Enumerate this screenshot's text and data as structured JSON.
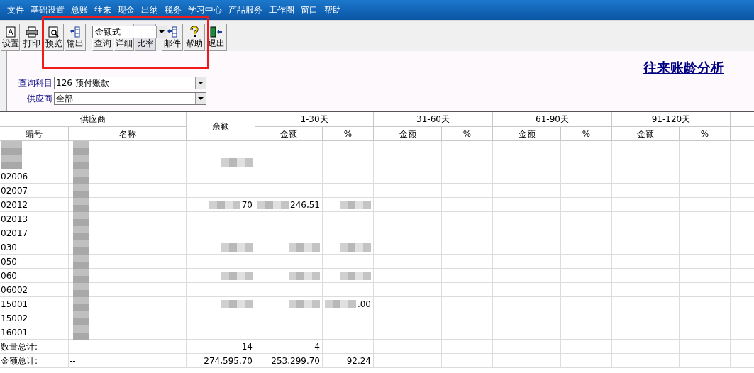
{
  "menu": [
    "文件",
    "基础设置",
    "总账",
    "往来",
    "现金",
    "出纳",
    "税务",
    "学习中心",
    "产品服务",
    "工作圈",
    "窗口",
    "帮助"
  ],
  "toolbar": [
    {
      "label": "设置"
    },
    {
      "label": "打印"
    },
    {
      "label": "预览"
    },
    {
      "label": "输出"
    },
    {
      "label": "查询"
    },
    {
      "label": "详细"
    },
    {
      "label": "比率"
    },
    {
      "label": "邮件"
    },
    {
      "label": "帮助"
    },
    {
      "label": "退出"
    }
  ],
  "mode_select": {
    "value": "金额式"
  },
  "report_title": "往来账龄分析",
  "filters": [
    {
      "label": "查询科目",
      "value": "126 预付账款"
    },
    {
      "label": "供应商",
      "value": "全部"
    }
  ],
  "table": {
    "group_headers": [
      "供应商",
      "余额",
      "1-30天",
      "31-60天",
      "61-90天",
      "91-120天"
    ],
    "sub_headers": [
      "编号",
      "名称",
      "金额",
      "%",
      "金额",
      "%",
      "金额",
      "%",
      "金额",
      "%"
    ],
    "rows": [
      {
        "cells": [
          "",
          "",
          "",
          "",
          "",
          "",
          "",
          "",
          "",
          "",
          ""
        ],
        "pixelated": [
          true,
          true,
          false,
          false,
          false,
          false,
          false,
          false,
          false,
          false,
          false
        ]
      },
      {
        "cells": [
          "",
          "",
          "",
          "",
          "",
          "",
          "",
          "",
          "",
          "",
          ""
        ],
        "pixelated": [
          true,
          true,
          true,
          false,
          false,
          false,
          false,
          false,
          false,
          false,
          false
        ]
      },
      {
        "cells": [
          "02006",
          "",
          "",
          "",
          "",
          "",
          "",
          "",
          "",
          "",
          ""
        ],
        "pixelated": [
          false,
          true,
          false,
          false,
          false,
          false,
          false,
          false,
          false,
          false,
          false
        ]
      },
      {
        "cells": [
          "02007",
          "",
          "",
          "",
          "",
          "",
          "",
          "",
          "",
          "",
          ""
        ],
        "pixelated": [
          false,
          true,
          false,
          false,
          false,
          false,
          false,
          false,
          false,
          false,
          false
        ]
      },
      {
        "cells": [
          "02012",
          "",
          "70",
          "246,51",
          "",
          "",
          "",
          "",
          "",
          "",
          ""
        ],
        "pixelated": [
          false,
          true,
          true,
          true,
          true,
          false,
          false,
          false,
          false,
          false,
          false
        ]
      },
      {
        "cells": [
          "02013",
          "",
          "",
          "",
          "",
          "",
          "",
          "",
          "",
          "",
          ""
        ],
        "pixelated": [
          false,
          true,
          false,
          false,
          false,
          false,
          false,
          false,
          false,
          false,
          false
        ]
      },
      {
        "cells": [
          "02017",
          "",
          "",
          "",
          "",
          "",
          "",
          "",
          "",
          "",
          ""
        ],
        "pixelated": [
          false,
          true,
          false,
          false,
          false,
          false,
          false,
          false,
          false,
          false,
          false
        ]
      },
      {
        "cells": [
          "030",
          "",
          "",
          "",
          "",
          "",
          "",
          "",
          "",
          "",
          ""
        ],
        "pixelated": [
          false,
          true,
          true,
          true,
          true,
          false,
          false,
          false,
          false,
          false,
          false
        ]
      },
      {
        "cells": [
          "050",
          "",
          "",
          "",
          "",
          "",
          "",
          "",
          "",
          "",
          ""
        ],
        "pixelated": [
          false,
          true,
          false,
          false,
          false,
          false,
          false,
          false,
          false,
          false,
          false
        ]
      },
      {
        "cells": [
          "060",
          "",
          "",
          "",
          "",
          "",
          "",
          "",
          "",
          "",
          ""
        ],
        "pixelated": [
          false,
          true,
          true,
          true,
          true,
          false,
          false,
          false,
          false,
          false,
          false
        ]
      },
      {
        "cells": [
          "06002",
          "",
          "",
          "",
          "",
          "",
          "",
          "",
          "",
          "",
          ""
        ],
        "pixelated": [
          false,
          true,
          false,
          false,
          false,
          false,
          false,
          false,
          false,
          false,
          false
        ]
      },
      {
        "cells": [
          "15001",
          "",
          "",
          "",
          ".00",
          "",
          "",
          "",
          "",
          "",
          ""
        ],
        "pixelated": [
          false,
          true,
          true,
          true,
          true,
          false,
          false,
          false,
          false,
          false,
          false
        ]
      },
      {
        "cells": [
          "15002",
          "",
          "",
          "",
          "",
          "",
          "",
          "",
          "",
          "",
          ""
        ],
        "pixelated": [
          false,
          true,
          false,
          false,
          false,
          false,
          false,
          false,
          false,
          false,
          false
        ]
      },
      {
        "cells": [
          "16001",
          "",
          "",
          "",
          "",
          "",
          "",
          "",
          "",
          "",
          ""
        ],
        "pixelated": [
          false,
          true,
          false,
          false,
          false,
          false,
          false,
          false,
          false,
          false,
          false
        ]
      },
      {
        "cells": [
          "数量总计:",
          "--",
          "14",
          "4",
          "",
          "",
          "",
          "",
          "",
          "",
          ""
        ],
        "pixelated": [
          false,
          false,
          false,
          false,
          false,
          false,
          false,
          false,
          false,
          false,
          false
        ]
      },
      {
        "cells": [
          "金额总计:",
          "--",
          "274,595.70",
          "253,299.70",
          "92.24",
          "",
          "",
          "",
          "",
          "",
          ""
        ],
        "pixelated": [
          false,
          false,
          false,
          false,
          false,
          false,
          false,
          false,
          false,
          false,
          false
        ]
      }
    ]
  }
}
